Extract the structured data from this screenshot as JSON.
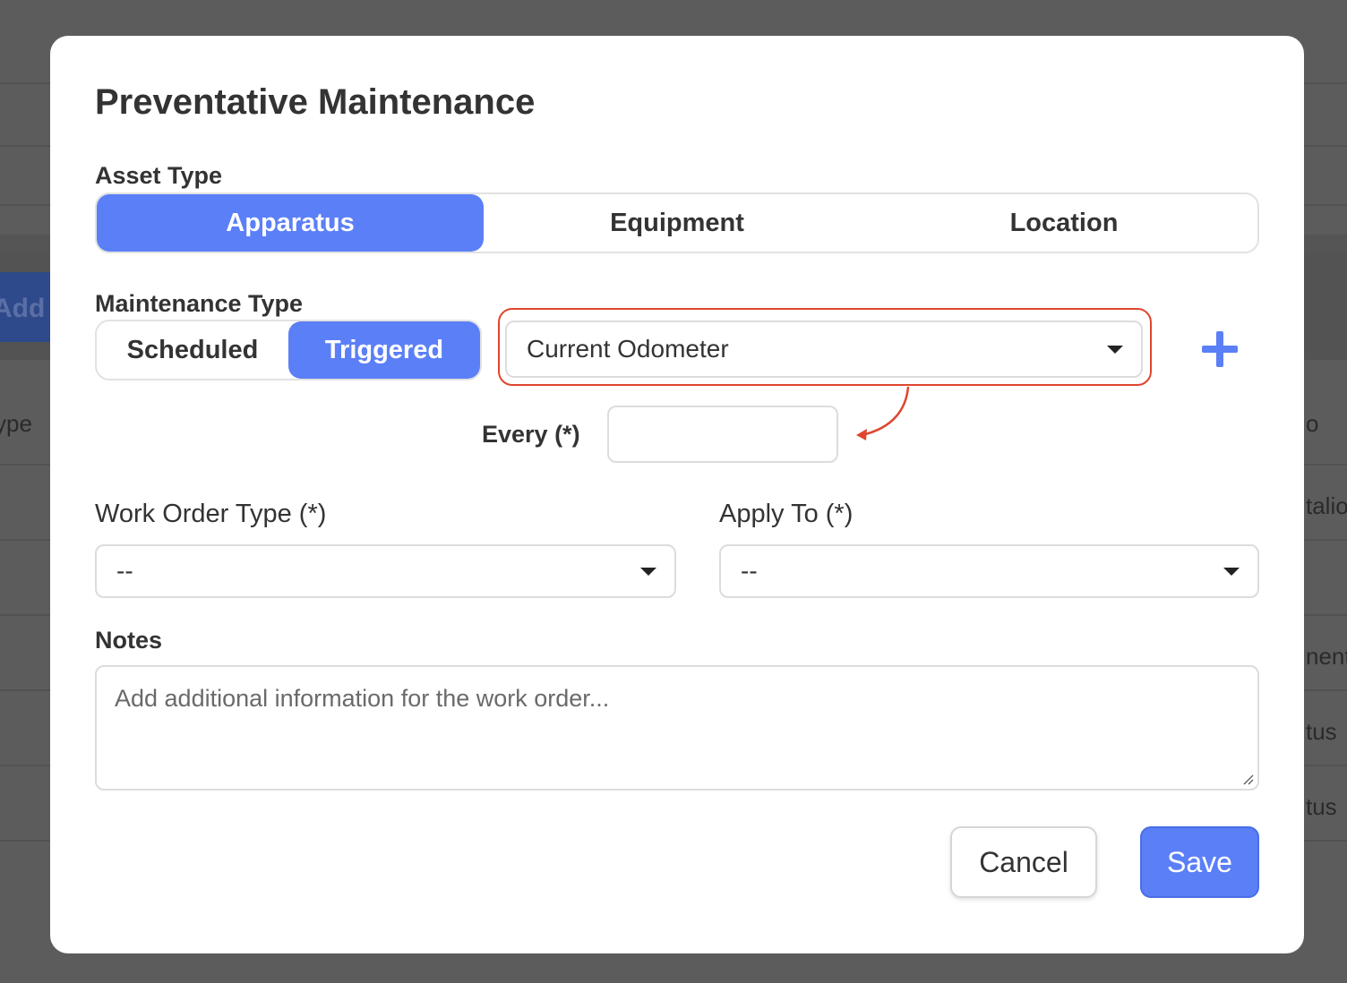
{
  "background": {
    "add_button_label": "Add M",
    "column_fragment_left": "ype",
    "right_fragments": [
      "o",
      "talio",
      "nent",
      "tus",
      "tus"
    ]
  },
  "modal": {
    "title": "Preventative Maintenance",
    "asset_type": {
      "label": "Asset Type",
      "options": [
        "Apparatus",
        "Equipment",
        "Location"
      ],
      "selected": "Apparatus"
    },
    "maintenance_type": {
      "label": "Maintenance Type",
      "options": [
        "Scheduled",
        "Triggered"
      ],
      "selected": "Triggered"
    },
    "trigger_select": {
      "value": "Current Odometer",
      "highlight_color": "#e0452e"
    },
    "add_icon": "plus-icon",
    "every": {
      "label": "Every (*)",
      "value": ""
    },
    "work_order_type": {
      "label": "Work Order Type (*)",
      "value": "--"
    },
    "apply_to": {
      "label": "Apply To (*)",
      "value": "--"
    },
    "notes": {
      "label": "Notes",
      "placeholder": "Add additional information for the work order..."
    },
    "buttons": {
      "cancel": "Cancel",
      "save": "Save"
    }
  },
  "colors": {
    "accent": "#5b7ff7",
    "overlay": "#5c5c5c",
    "annotation": "#e0452e"
  }
}
